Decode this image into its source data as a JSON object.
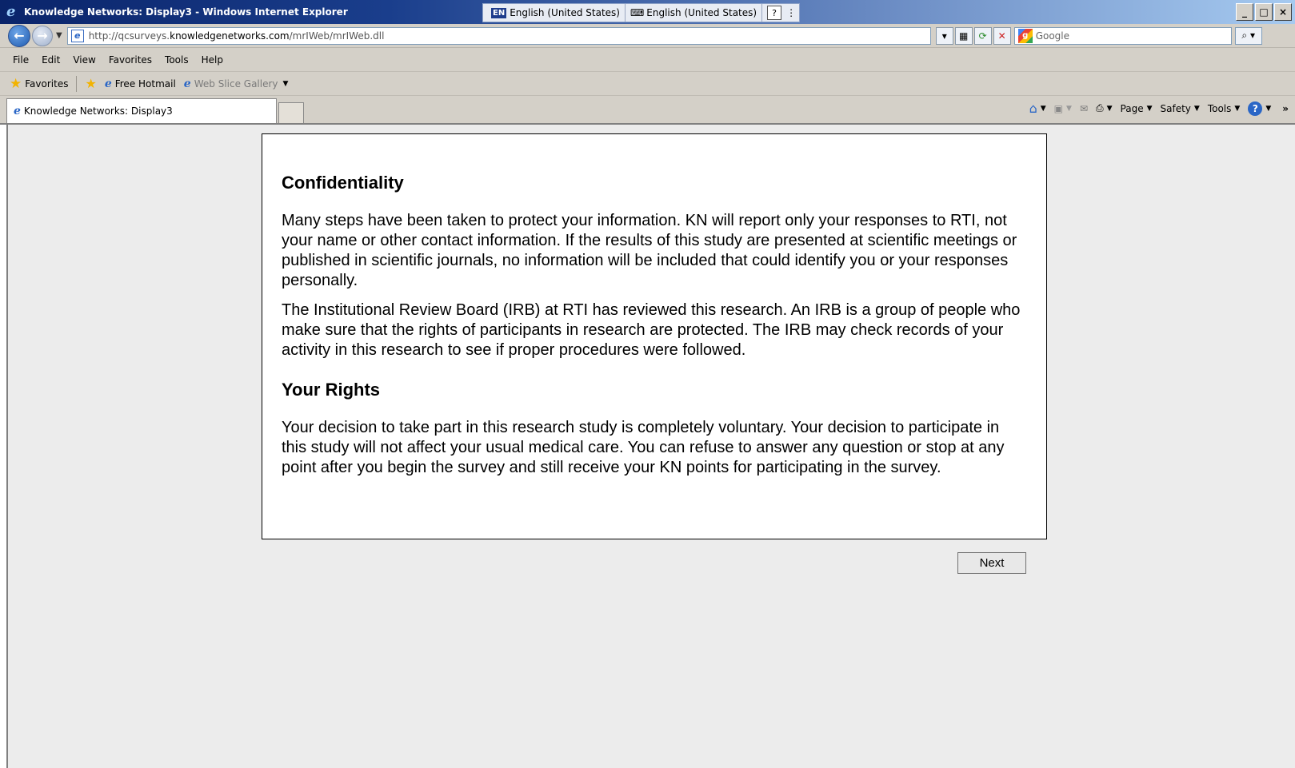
{
  "window": {
    "title": "Knowledge Networks: Display3 - Windows Internet Explorer",
    "controls": [
      "_",
      "□",
      "×"
    ]
  },
  "language_bar": {
    "badge": "EN",
    "input_language": "English (United States)",
    "keyboard_layout": "English (United States)",
    "help": "?"
  },
  "address_bar": {
    "url_prefix": "http://qcsurveys.",
    "url_domain": "knowledgenetworks.com",
    "url_path": "/mrIWeb/mrIWeb.dll",
    "search_placeholder": "Google"
  },
  "menu": {
    "items": [
      "File",
      "Edit",
      "View",
      "Favorites",
      "Tools",
      "Help"
    ]
  },
  "favorites_bar": {
    "favorites_label": "Favorites",
    "links": [
      "Free Hotmail",
      "Web Slice Gallery"
    ]
  },
  "tab": {
    "label": "Knowledge Networks: Display3"
  },
  "command_bar": {
    "page": "Page",
    "safety": "Safety",
    "tools": "Tools",
    "more": "»"
  },
  "survey": {
    "section1_title": "Confidentiality",
    "paragraph1": "Many steps have been taken to protect your information. KN will report only your responses to RTI, not your name or other contact information. If the results of this study are presented at scientific meetings or published in scientific journals, no information will be included that could identify you or your responses personally.",
    "paragraph2": "The Institutional Review Board (IRB) at RTI has reviewed this research. An IRB is a group of people who make sure that the rights of participants in research are protected. The IRB may check records of your activity in this research to see if proper procedures were followed.",
    "section2_title": "Your Rights",
    "paragraph3": "Your decision to take part in this research study is completely voluntary. Your decision to participate in this study will not affect your usual medical care. You can refuse to answer any question or stop at any point after you begin the survey and still receive your KN points for participating in the survey.",
    "next_button": "Next"
  }
}
